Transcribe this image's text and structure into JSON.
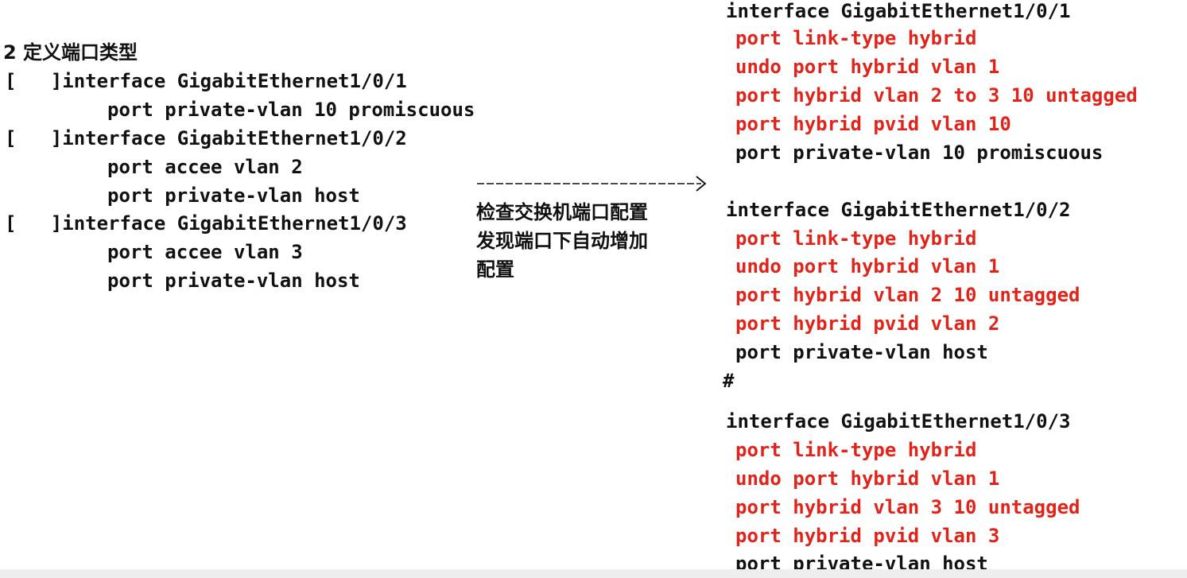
{
  "left": {
    "heading": "2 定义端口类型",
    "blocks": [
      {
        "bracket_line": "[   ]interface GigabitEthernet1/0/1",
        "commands": [
          "port private-vlan 10 promiscuous"
        ]
      },
      {
        "bracket_line": "[   ]interface GigabitEthernet1/0/2",
        "commands": [
          "port accee vlan 2",
          "port private-vlan host"
        ]
      },
      {
        "bracket_line": "[   ]interface GigabitEthernet1/0/3",
        "commands": [
          "port accee vlan 3",
          "port private-vlan host"
        ]
      }
    ]
  },
  "middle": {
    "note_lines": [
      "检查交换机端口配置",
      "发现端口下自动增加",
      "配置"
    ]
  },
  "right": {
    "separator": "#",
    "blocks": [
      {
        "header": "interface GigabitEthernet1/0/1",
        "auto_lines": [
          "port link-type hybrid",
          "undo port hybrid vlan 1",
          "port hybrid vlan 2 to 3 10 untagged",
          "port hybrid pvid vlan 10"
        ],
        "user_line": "port private-vlan 10 promiscuous"
      },
      {
        "header": "interface GigabitEthernet1/0/2",
        "auto_lines": [
          "port link-type hybrid",
          "undo port hybrid vlan 1",
          "port hybrid vlan 2 10 untagged",
          "port hybrid pvid vlan 2"
        ],
        "user_line": "port private-vlan host"
      },
      {
        "header": "interface GigabitEthernet1/0/3",
        "auto_lines": [
          "port link-type hybrid",
          "undo port hybrid vlan 1",
          "port hybrid vlan 3 10 untagged",
          "port hybrid pvid vlan 3"
        ],
        "user_line": "port private-vlan host"
      }
    ]
  },
  "colors": {
    "auto_config": "#e2231a",
    "text": "#111111",
    "background": "#ffffff"
  }
}
